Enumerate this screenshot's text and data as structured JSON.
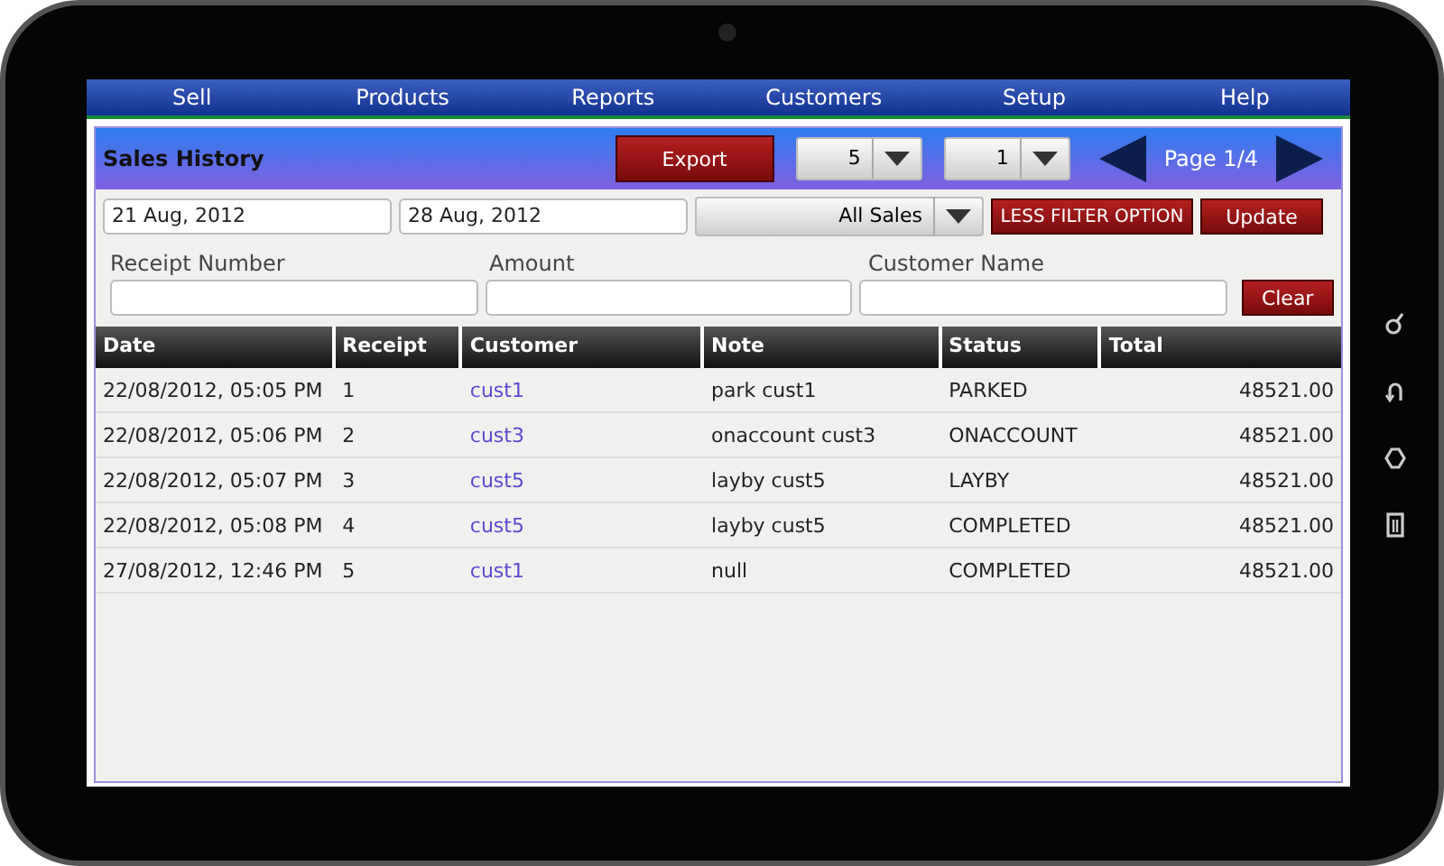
{
  "menu": [
    {
      "label": "Sell"
    },
    {
      "label": "Products"
    },
    {
      "label": "Reports"
    },
    {
      "label": "Customers"
    },
    {
      "label": "Setup"
    },
    {
      "label": "Help"
    }
  ],
  "header": {
    "title": "Sales History",
    "export": "Export",
    "page_size": "5",
    "page_number": "1",
    "page_label": "Page 1/4"
  },
  "filters": {
    "date_from": "21 Aug, 2012",
    "date_to": "28 Aug, 2012",
    "sale_type": "All Sales",
    "less_button": "LESS FILTER OPTION",
    "update_button": "Update",
    "receipt_label": "Receipt Number",
    "amount_label": "Amount",
    "customer_label": "Customer Name",
    "clear_button": "Clear"
  },
  "table": {
    "columns": [
      "Date",
      "Receipt",
      "Customer",
      "Note",
      "Status",
      "Total"
    ],
    "rows": [
      [
        "22/08/2012, 05:05 PM",
        "1",
        "cust1",
        "park cust1",
        "PARKED",
        "48521.00"
      ],
      [
        "22/08/2012, 05:06 PM",
        "2",
        "cust3",
        "onaccount cust3",
        "ONACCOUNT",
        "48521.00"
      ],
      [
        "22/08/2012, 05:07 PM",
        "3",
        "cust5",
        "layby cust5",
        "LAYBY",
        "48521.00"
      ],
      [
        "22/08/2012, 05:08 PM",
        "4",
        "cust5",
        "layby cust5",
        "COMPLETED",
        "48521.00"
      ],
      [
        "27/08/2012, 12:46 PM",
        "5",
        "cust1",
        "null",
        "COMPLETED",
        "48521.00"
      ]
    ]
  }
}
